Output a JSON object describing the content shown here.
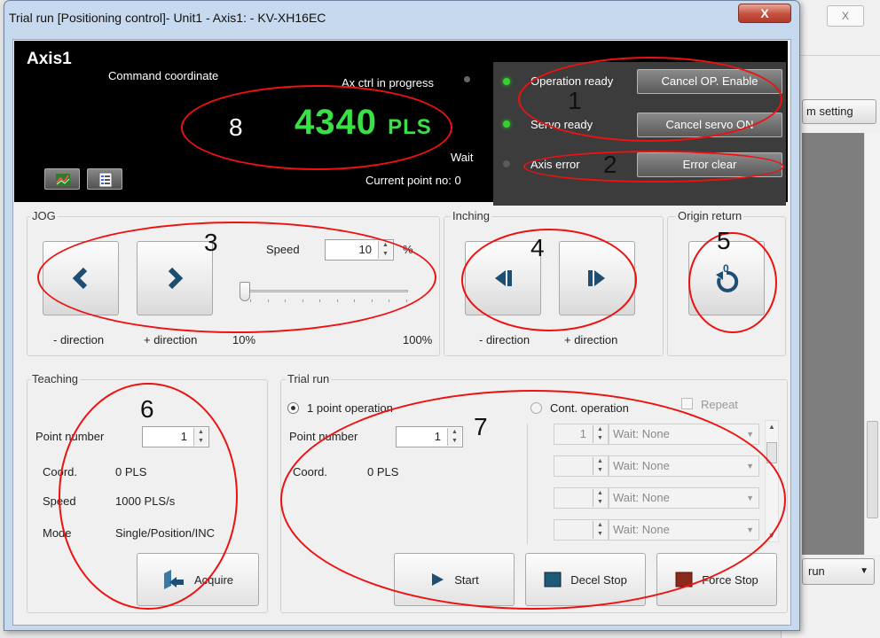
{
  "window": {
    "title": "Trial run [Positioning control]- Unit1 - Axis1: - KV-XH16EC",
    "close_label": "X"
  },
  "background_window": {
    "close_label": "X",
    "setting_button": "m setting",
    "combo_value": "run"
  },
  "status": {
    "axis_name": "Axis1",
    "coord_label": "Command coordinate",
    "ax_ctrl_label": "Ax ctrl in progress",
    "value": "4340",
    "unit": "PLS",
    "wait_label": "Wait",
    "current_point": "Current point no: 0",
    "operation_ready": "Operation ready",
    "servo_ready": "Servo ready",
    "axis_error": "Axis error",
    "cancel_op_enable": "Cancel OP. Enable",
    "cancel_servo_on": "Cancel servo ON",
    "error_clear": "Error clear",
    "colors": {
      "value": "#39e046",
      "led_on": "#34d12f",
      "led_off": "#5a5a5a",
      "annotation": "#e11111"
    }
  },
  "jog": {
    "title": "JOG",
    "speed_label": "Speed",
    "speed_value": "10",
    "percent": "%",
    "minus_label": "- direction",
    "plus_label": "+ direction",
    "min_label": "10%",
    "max_label": "100%",
    "speed_level": 0.0
  },
  "inching": {
    "title": "Inching",
    "minus_label": "- direction",
    "plus_label": "+ direction"
  },
  "origin": {
    "title": "Origin return",
    "icon_label": "0"
  },
  "teaching": {
    "title": "Teaching",
    "point_label": "Point number",
    "point_value": "1",
    "coord_label": "Coord.",
    "coord_value": "0 PLS",
    "speed_label": "Speed",
    "speed_value": "1000 PLS/s",
    "mode_label": "Mode",
    "mode_value": "Single/Position/INC",
    "acquire_label": "Acquire"
  },
  "trial": {
    "title": "Trial run",
    "one_point_label": "1 point operation",
    "cont_label": "Cont. operation",
    "repeat_label": "Repeat",
    "point_label": "Point number",
    "point_value": "1",
    "coord_label": "Coord.",
    "coord_value": "0 PLS",
    "cont_rows": [
      {
        "num": "1",
        "wait": "Wait: None"
      },
      {
        "num": "",
        "wait": "Wait: None"
      },
      {
        "num": "",
        "wait": "Wait: None"
      },
      {
        "num": "",
        "wait": "Wait: None"
      }
    ],
    "start_label": "Start",
    "decel_label": "Decel Stop",
    "force_label": "Force Stop"
  },
  "annotations": [
    "1",
    "2",
    "3",
    "4",
    "5",
    "6",
    "7",
    "8"
  ]
}
